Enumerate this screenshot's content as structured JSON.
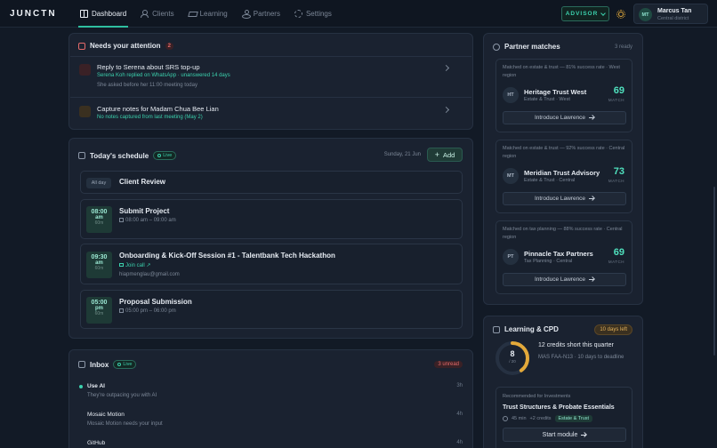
{
  "app": {
    "logo": "JUNCTN"
  },
  "nav": [
    {
      "label": "Dashboard",
      "icon": "grid-icon"
    },
    {
      "label": "Clients",
      "icon": "user-icon"
    },
    {
      "label": "Learning",
      "icon": "graduation-cap-icon"
    },
    {
      "label": "Partners",
      "icon": "network-icon"
    },
    {
      "label": "Settings",
      "icon": "gear-icon"
    }
  ],
  "header": {
    "role_label": "ADVISOR",
    "user": {
      "initials": "MT",
      "name": "Marcus Tan",
      "location": "Central district"
    }
  },
  "attention": {
    "title": "Needs your attention",
    "count": "2",
    "items": [
      {
        "title": "Reply to Serena about SRS top-up",
        "sub": "Serena Koh replied on WhatsApp · unanswered 14 days",
        "note": "She asked before her 11:00 meeting today"
      },
      {
        "title": "Capture notes for Madam Chua Bee Lian",
        "sub": "No notes captured from last meeting (May 2)"
      }
    ]
  },
  "schedule": {
    "title": "Today's schedule",
    "live": "Live",
    "date": "Sunday, 21 Jun",
    "add_label": "Add",
    "allday": {
      "tag": "All day",
      "title": "Client Review"
    },
    "events": [
      {
        "time": "08:00",
        "ampm": "am",
        "dur": "60m",
        "title": "Submit Project",
        "range": "08:00 am – 09:00 am"
      },
      {
        "time": "09:30",
        "ampm": "am",
        "dur": "60m",
        "title": "Onboarding & Kick-Off Session #1 - Talentbank Tech Hackathon",
        "link": "Join call",
        "email": "hiapmenglau@gmail.com"
      },
      {
        "time": "05:00",
        "ampm": "pm",
        "dur": "60m",
        "title": "Proposal Submission",
        "range": "05:00 pm – 06:00 pm"
      }
    ]
  },
  "inbox": {
    "title": "Inbox",
    "live": "Live",
    "unread": "3 unread",
    "items": [
      {
        "title": "Use AI",
        "sub": "They're outpacing you with AI",
        "time": "3h",
        "unread": true
      },
      {
        "title": "Mosaic Motion",
        "sub": "Mosaic Motion needs your input",
        "time": "4h"
      },
      {
        "title": "GitHub",
        "time": "4h"
      }
    ]
  },
  "partners": {
    "title": "Partner matches",
    "ready": "3 ready",
    "score_label": "MATCH",
    "cta": "Introduce Lawrence",
    "items": [
      {
        "reason": "Matched on estate & trust — 81% success rate · West region",
        "initials": "HT",
        "name": "Heritage Trust West",
        "meta": "Estate & Trust · West",
        "score": "69"
      },
      {
        "reason": "Matched on estate & trust — 92% success rate · Central region",
        "initials": "MT",
        "name": "Meridian Trust Advisory",
        "meta": "Estate & Trust · Central",
        "score": "73"
      },
      {
        "reason": "Matched on tax planning — 88% success rate · Central region",
        "initials": "PT",
        "name": "Pinnacle Tax Partners",
        "meta": "Tax Planning · Central",
        "score": "69"
      }
    ]
  },
  "learning": {
    "title": "Learning & CPD",
    "days_left": "10 days left",
    "credits": "8",
    "credits_of": "/ 20",
    "credits_fraction": 0.4,
    "short": "12 credits short this quarter",
    "sub": "MAS FAA-N13 · 10 days to deadline",
    "rec": {
      "label": "Recommended for Investments",
      "title": "Trust Structures & Probate Essentials",
      "duration": "45 min",
      "credits": "+2 credits",
      "tag": "Estate & Trust",
      "cta": "Start module"
    }
  },
  "colors": {
    "accent": "#3bd1ad",
    "warning": "#e3a93a",
    "danger": "#e46a6a",
    "background": "#121a26"
  }
}
